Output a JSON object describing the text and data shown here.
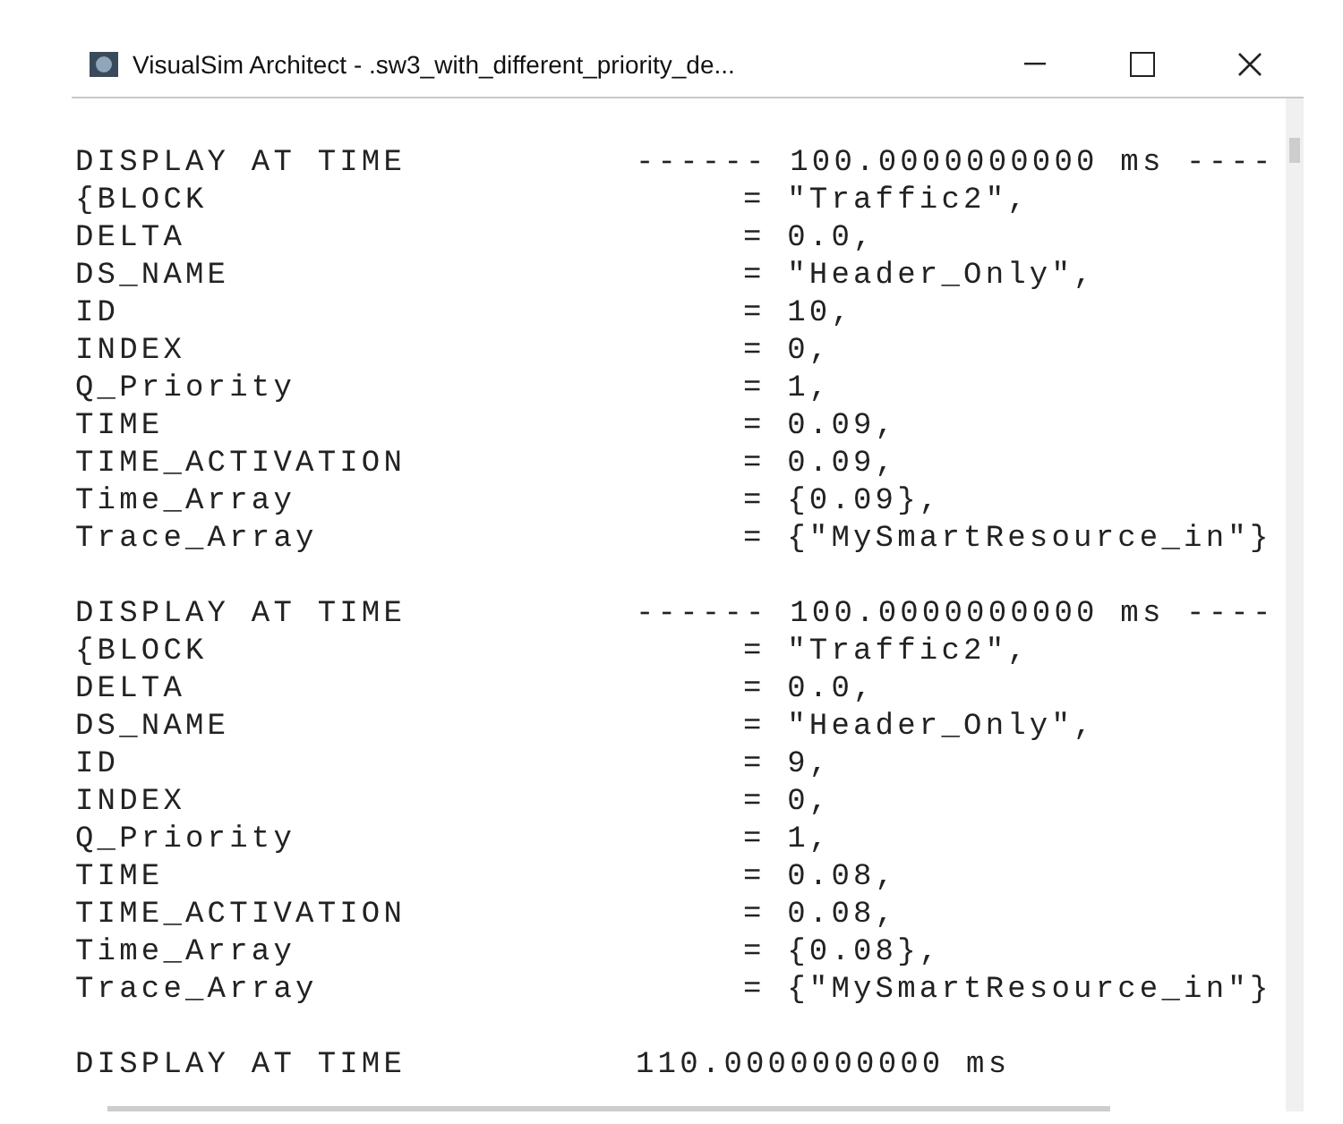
{
  "window": {
    "title": "VisualSim Architect - .sw3_with_different_priority_de..."
  },
  "blocks": [
    {
      "header": {
        "label": "DISPLAY AT TIME",
        "value": "------ 100.0000000000 ms ----"
      },
      "fields": [
        {
          "name": "{BLOCK",
          "value": "= \"Traffic2\","
        },
        {
          "name": "DELTA",
          "value": "= 0.0,"
        },
        {
          "name": "DS_NAME",
          "value": "= \"Header_Only\","
        },
        {
          "name": "ID",
          "value": "= 10,"
        },
        {
          "name": "INDEX",
          "value": "= 0,"
        },
        {
          "name": "Q_Priority",
          "value": "= 1,"
        },
        {
          "name": "TIME",
          "value": "= 0.09,"
        },
        {
          "name": "TIME_ACTIVATION",
          "value": "= 0.09,"
        },
        {
          "name": "Time_Array",
          "value": "= {0.09},"
        },
        {
          "name": "Trace_Array",
          "value": "= {\"MySmartResource_in\"}"
        }
      ]
    },
    {
      "header": {
        "label": "DISPLAY AT TIME",
        "value": "------ 100.0000000000 ms ----"
      },
      "fields": [
        {
          "name": "{BLOCK",
          "value": "= \"Traffic2\","
        },
        {
          "name": "DELTA",
          "value": "= 0.0,"
        },
        {
          "name": "DS_NAME",
          "value": "= \"Header_Only\","
        },
        {
          "name": "ID",
          "value": "= 9,"
        },
        {
          "name": "INDEX",
          "value": "= 0,"
        },
        {
          "name": "Q_Priority",
          "value": "= 1,"
        },
        {
          "name": "TIME",
          "value": "= 0.08,"
        },
        {
          "name": "TIME_ACTIVATION",
          "value": "= 0.08,"
        },
        {
          "name": "Time_Array",
          "value": "= {0.08},"
        },
        {
          "name": "Trace_Array",
          "value": "= {\"MySmartResource_in\"}"
        }
      ]
    },
    {
      "header": {
        "label": "DISPLAY AT TIME",
        "value": "110.0000000000 ms"
      }
    }
  ]
}
